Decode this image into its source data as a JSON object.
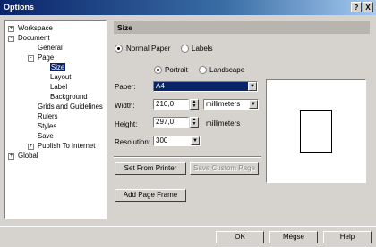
{
  "window": {
    "title": "Options",
    "help_glyph": "?",
    "close_glyph": "X"
  },
  "tree": {
    "workspace": "Workspace",
    "document": "Document",
    "general": "General",
    "page": "Page",
    "size": "Size",
    "layout": "Layout",
    "label": "Label",
    "background": "Background",
    "grids": "Grids and Guidelines",
    "rulers": "Rulers",
    "styles": "Styles",
    "save": "Save",
    "publish": "Publish To Internet",
    "global": "Global",
    "expand_glyph": "+",
    "collapse_glyph": "-"
  },
  "panel": {
    "heading": "Size",
    "normal_paper": "Normal Paper",
    "labels": "Labels",
    "portrait": "Portrait",
    "landscape": "Landscape",
    "paper_label": "Paper:",
    "paper_value": "A4",
    "width_label": "Width:",
    "width_value": "210,0",
    "width_unit": "millimeters",
    "height_label": "Height:",
    "height_value": "297,0",
    "height_unit": "millimeters",
    "resolution_label": "Resolution:",
    "resolution_value": "300",
    "set_from_printer": "Set From Printer",
    "save_custom_page": "Save Custom Page",
    "add_page_frame": "Add Page Frame"
  },
  "footer": {
    "ok": "OK",
    "cancel": "Mégse",
    "help": "Help"
  },
  "colors": {
    "selection": "#0a246a",
    "dialog_bg": "#d6d3ce",
    "title_start": "#0a246a"
  }
}
